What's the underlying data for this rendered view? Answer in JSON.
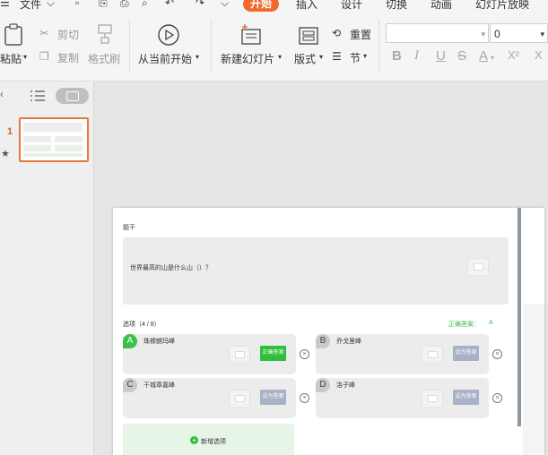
{
  "menu": {
    "file": "文件",
    "tabs": [
      "开始",
      "插入",
      "设计",
      "切换",
      "动画",
      "幻灯片放映"
    ],
    "active_tab": "开始"
  },
  "ribbon": {
    "paste": "粘贴",
    "cut": "剪切",
    "copy": "复制",
    "format_painter": "格式刷",
    "play_from_current": "从当前开始",
    "new_slide": "新建幻灯片",
    "layout": "版式",
    "reset": "重置",
    "section": "节",
    "font_size": "0",
    "format_buttons": [
      "B",
      "I",
      "U",
      "S",
      "A",
      "X²",
      "X"
    ]
  },
  "left_panel": {
    "slide_number": "1"
  },
  "slide": {
    "stem_label": "题干",
    "question": "世界最高的山是什么山（）？",
    "options_label": "选项（4 / 8）",
    "answer_label": "正确答案：",
    "answer_value": "A",
    "options": [
      {
        "letter": "A",
        "text": "珠穆朗玛峰",
        "button": "正确答案",
        "correct": true
      },
      {
        "letter": "B",
        "text": "乔戈里峰",
        "button": "设为答案",
        "correct": false
      },
      {
        "letter": "C",
        "text": "干城章嘉峰",
        "button": "设为答案",
        "correct": false
      },
      {
        "letter": "D",
        "text": "洛子峰",
        "button": "设为答案",
        "correct": false
      }
    ],
    "add_option": "新增选项",
    "remove_symbol": "×"
  },
  "colors": {
    "accent": "#f06a2b",
    "correct": "#2fbf3c",
    "answer_text": "#3cb44b",
    "set_answer": "#aab1c7"
  }
}
